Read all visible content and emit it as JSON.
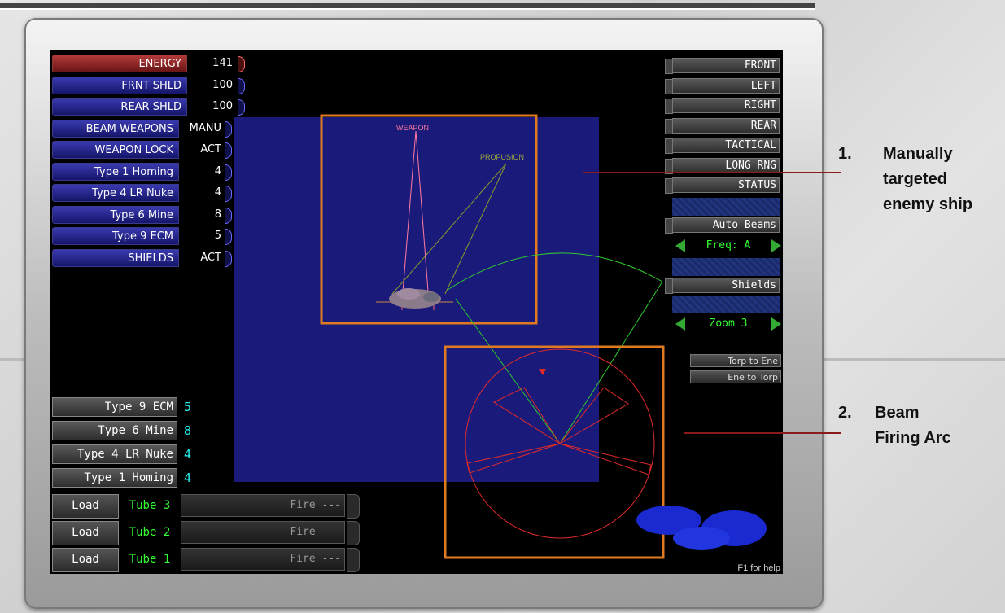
{
  "status_panel": [
    {
      "label": "ENERGY",
      "value": "141",
      "color": "#a02a2a"
    },
    {
      "label": "FRNT SHLD",
      "value": "100"
    },
    {
      "label": "REAR SHLD",
      "value": "100"
    },
    {
      "label": "BEAM WEAPONS",
      "value": "MANU"
    },
    {
      "label": "WEAPON LOCK",
      "value": "ACT"
    },
    {
      "label": "Type 1 Homing",
      "value": "4"
    },
    {
      "label": "Type 4 LR Nuke",
      "value": "4"
    },
    {
      "label": "Type 6 Mine",
      "value": "8"
    },
    {
      "label": "Type 9 ECM",
      "value": "5"
    },
    {
      "label": "SHIELDS",
      "value": "ACT"
    }
  ],
  "view_menu": [
    "FRONT",
    "LEFT",
    "RIGHT",
    "REAR",
    "TACTICAL",
    "LONG RNG",
    "STATUS"
  ],
  "auto_beams_label": "Auto Beams",
  "freq_label": "Freq: A",
  "shields_label": "Shields",
  "zoom_label": "Zoom 3",
  "torp_to_ene_label": "Torp to Ene",
  "ene_to_torp_label": "Ene to Torp",
  "weapon_list": [
    {
      "label": "Type 9 ECM",
      "count": "5"
    },
    {
      "label": "Type 6 Mine",
      "count": "8"
    },
    {
      "label": "Type 4 LR Nuke",
      "count": "4"
    },
    {
      "label": "Type 1 Homing",
      "count": "4"
    }
  ],
  "tubes": [
    {
      "load": "Load",
      "name": "Tube 3",
      "fire": "Fire ---"
    },
    {
      "load": "Load",
      "name": "Tube 2",
      "fire": "Fire ---"
    },
    {
      "load": "Load",
      "name": "Tube 1",
      "fire": "Fire ---"
    }
  ],
  "target_labels": {
    "weapon": "WEAPON",
    "propulsion": "PROPUSION"
  },
  "help_text": "F1 for help",
  "annotations": [
    {
      "number": "1.",
      "lines": [
        "Manually",
        "targeted",
        "enemy ship"
      ]
    },
    {
      "number": "2.",
      "lines": [
        "Beam",
        "Firing Arc"
      ]
    }
  ],
  "colors": {
    "accent_orange": "#e07a20",
    "beam_arc": "#e02a2a",
    "arc_green": "#2ecc2e",
    "panel_blue": "#23238a"
  }
}
